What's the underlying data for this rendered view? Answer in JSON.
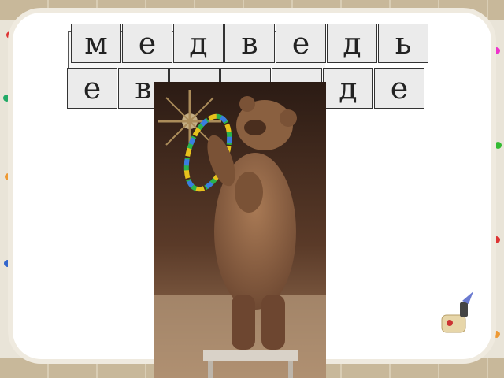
{
  "word_row": {
    "letters": [
      "м",
      "е",
      "д",
      "в",
      "е",
      "д",
      "ь"
    ]
  },
  "scrambled_row": {
    "letters": [
      "е",
      "в",
      "",
      "",
      "",
      "д",
      "е"
    ]
  },
  "photo": {
    "subject": "bear-with-hoop"
  },
  "colors": {
    "tile_bg": "#ebebeb",
    "panel_bg": "#ffffff",
    "frame_bg": "#e9e4d8"
  }
}
